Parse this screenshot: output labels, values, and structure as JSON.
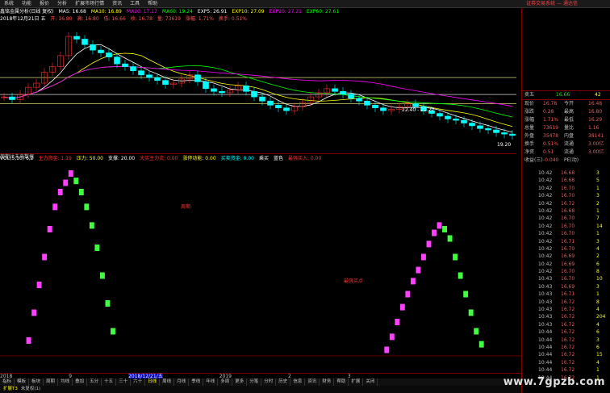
{
  "menu": [
    "系统",
    "功能",
    "报价",
    "分析",
    "扩展市场行情",
    "资讯",
    "工具",
    "帮助"
  ],
  "broker_banner": "证券交易系统 — 通达信",
  "info_line1": [
    "鑫铭金属分析(日线 复权)",
    "MA5: 16.68",
    "MA10: 16.89",
    "MA20: 17.17",
    "MA60: 19.24",
    "EXP5: 26.91",
    "EXP10: 27.09",
    "EXP20: 27.21",
    "EXP60: 27.61"
  ],
  "info_line2": [
    "2018年12月21日 五",
    "开: 16.80",
    "高: 16.80",
    "低: 16.66",
    "收: 16.78",
    "量: 73619",
    "涨幅: 1.71%",
    "换手: 0.51%"
  ],
  "price_labels": [
    "22.40 - 22.22",
    "19.20"
  ],
  "candle_footer": "周期计未来数据",
  "ind_line": [
    "VOL(5,10) 6,2",
    "主力资金: 1.19",
    "压力: 50.00",
    "支撑: 20.00",
    "大买主力流: 0.00",
    "涨停动能: 0.00",
    "买卖资金: 0.00",
    "乘买",
    "蓝色",
    "最强买入: 0.00"
  ],
  "sub_labels": {
    "tag1": "周期",
    "tag2": "最强买点"
  },
  "sub_footer": [
    "2018",
    "9",
    "2018/12/21/五",
    "2019",
    "2",
    "3"
  ],
  "sub_footer_highlight": "2018/12/21/五",
  "tabs": [
    "指标",
    "模板",
    "板块",
    "周期",
    "均线",
    "叠加",
    "五分",
    "十五",
    "三十",
    "六十",
    "日线",
    "周线",
    "月线",
    "季线",
    "年线",
    "多周",
    "更多",
    "分笔",
    "分时",
    "历史",
    "信息",
    "资讯",
    "财务",
    "帮助",
    "扩展",
    "关闭"
  ],
  "status": [
    "扩展T3",
    "未复权(1)"
  ],
  "right_panel": {
    "code_row": [
      "卖五",
      "16.66",
      "42"
    ],
    "rows": [
      [
        "现价",
        "16.78",
        "今开",
        "16.48"
      ],
      [
        "涨跌",
        "0.28",
        "最高",
        "16.80"
      ],
      [
        "涨幅",
        "1.71%",
        "最低",
        "16.29"
      ],
      [
        "总量",
        "73619",
        "量比",
        "1.16"
      ],
      [
        "外盘",
        "35478",
        "内盘",
        "38141"
      ],
      [
        "换手",
        "0.51%",
        "流通",
        "3.00亿"
      ],
      [
        "净资",
        "0.51",
        "流通",
        "3.00亿"
      ],
      [
        "收益(三)",
        "-0.040",
        "PE(动)",
        ""
      ]
    ],
    "ticks": [
      [
        "10:42",
        "16.68",
        "3"
      ],
      [
        "10:42",
        "16.68",
        "5"
      ],
      [
        "10:42",
        "16.70",
        "1"
      ],
      [
        "10:42",
        "16.70",
        "3"
      ],
      [
        "10:42",
        "16.72",
        "2"
      ],
      [
        "10:42",
        "16.68",
        "1"
      ],
      [
        "10:42",
        "16.70",
        "7"
      ],
      [
        "10:42",
        "16.70",
        "14"
      ],
      [
        "10:42",
        "16.70",
        "1"
      ],
      [
        "10:42",
        "16.71",
        "3"
      ],
      [
        "10:42",
        "16.70",
        "4"
      ],
      [
        "10:42",
        "16.69",
        "2"
      ],
      [
        "10:42",
        "16.69",
        "6"
      ],
      [
        "10:42",
        "16.70",
        "8"
      ],
      [
        "10:43",
        "16.70",
        "10"
      ],
      [
        "10:43",
        "16.69",
        "3"
      ],
      [
        "10:43",
        "16.71",
        "1"
      ],
      [
        "10:43",
        "16.72",
        "8"
      ],
      [
        "10:43",
        "16.72",
        "4"
      ],
      [
        "10:43",
        "16.72",
        "204"
      ],
      [
        "10:43",
        "16.72",
        "4"
      ],
      [
        "10:44",
        "16.72",
        "6"
      ],
      [
        "10:44",
        "16.72",
        "3"
      ],
      [
        "10:44",
        "16.72",
        "6"
      ],
      [
        "10:44",
        "16.72",
        "15"
      ],
      [
        "10:44",
        "16.72",
        "4"
      ],
      [
        "10:44",
        "16.72",
        "1"
      ],
      [
        "10:44",
        "16.72",
        "1"
      ]
    ]
  },
  "watermark": "www.7gpzb.com",
  "chart_data": [
    {
      "type": "candlestick",
      "close": [
        19.6,
        19.4,
        19.8,
        20.3,
        20.6,
        21.4,
        21.8,
        22.6,
        24.0,
        23.8,
        23.4,
        23.0,
        22.8,
        22.5,
        22.0,
        21.8,
        21.5,
        21.2,
        21.0,
        20.8,
        20.5,
        20.6,
        20.9,
        21.2,
        20.7,
        20.2,
        20.0,
        19.9,
        20.1,
        20.4,
        20.0,
        19.6,
        19.3,
        19.0,
        18.8,
        18.6,
        18.9,
        19.2,
        19.6,
        19.9,
        20.2,
        20.0,
        19.8,
        19.5,
        19.3,
        19.0,
        18.8,
        18.6,
        18.7,
        18.9,
        19.1,
        18.9,
        18.6,
        18.4,
        18.2,
        18.0,
        17.9,
        17.7,
        17.5,
        17.3,
        17.2,
        17.0,
        16.9,
        16.8
      ],
      "ylim": [
        15.5,
        25.0
      ]
    },
    {
      "type": "bar",
      "magenta_green_wave": [
        0,
        0,
        0,
        0,
        0,
        10,
        25,
        40,
        55,
        70,
        82,
        90,
        95,
        100,
        96,
        90,
        82,
        72,
        60,
        45,
        30,
        15,
        0,
        0,
        0,
        0,
        0,
        0,
        0,
        0,
        0,
        0,
        0,
        0,
        0,
        0,
        0,
        0,
        0,
        0,
        0,
        0,
        0,
        0,
        0,
        0,
        0,
        0,
        0,
        0,
        0,
        0,
        0,
        0,
        0,
        0,
        0,
        0,
        0,
        0,
        0,
        0,
        0,
        0,
        0,
        0,
        0,
        0,
        0,
        0,
        0,
        0,
        0,
        5,
        12,
        20,
        28,
        35,
        42,
        48,
        55,
        62,
        68,
        72,
        70,
        65,
        55,
        45,
        35,
        25,
        15,
        8,
        0,
        0,
        0,
        0,
        0,
        0,
        0
      ],
      "ylim": [
        0,
        100
      ]
    }
  ]
}
